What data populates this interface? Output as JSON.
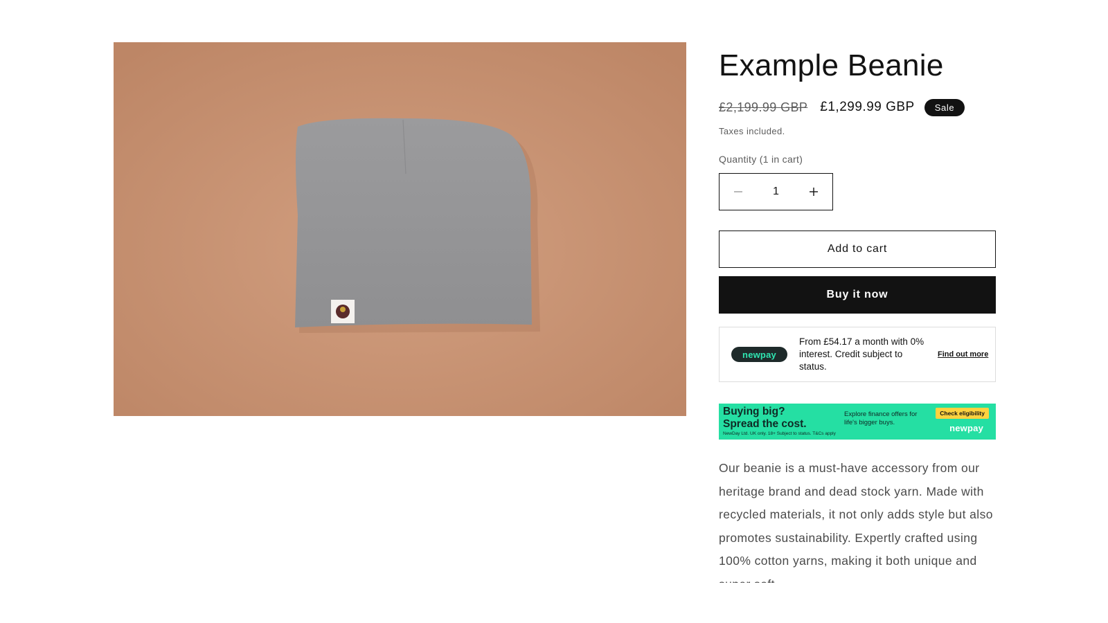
{
  "product": {
    "title": "Example Beanie",
    "price_compare": "£2,199.99 GBP",
    "price_sale": "£1,299.99 GBP",
    "badge": "Sale",
    "taxes_note": "Taxes included.",
    "quantity_label": "Quantity (1 in cart)",
    "quantity_value": "1",
    "add_to_cart_label": "Add to cart",
    "buy_now_label": "Buy it now",
    "description": "Our beanie is a must-have accessory from our heritage brand and dead stock yarn. Made with recycled materials, it not only adds style but also promotes sustainability. Expertly crafted using 100% cotton yarns, making it both unique and super soft."
  },
  "newpay": {
    "logo_text": "newpay",
    "offer_text": "From £54.17 a month with 0% interest. Credit subject to status.",
    "link_label": "Find out more"
  },
  "banner": {
    "headline_line1": "Buying big?",
    "headline_line2": "Spread the cost.",
    "subtext": "Explore finance offers for life's bigger buys.",
    "cta_label": "Check eligibility",
    "logo_text": "newpay",
    "fine_print": "NewDay Ltd. UK only. 18+ Subject to status. T&Cs apply"
  },
  "colors": {
    "brand_dark": "#121212",
    "newpay_green": "#25dfa3",
    "cta_yellow": "#ffd23f",
    "image_background": "#c89374"
  },
  "icons": {
    "minus": "minus-icon",
    "plus": "plus-icon"
  }
}
